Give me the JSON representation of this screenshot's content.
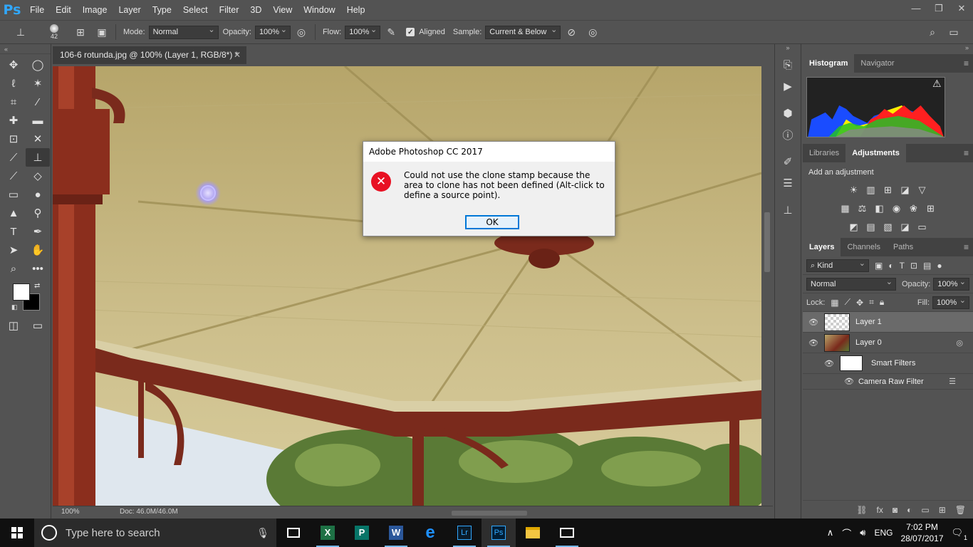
{
  "app": {
    "logo": "Ps"
  },
  "menu": [
    "File",
    "Edit",
    "Image",
    "Layer",
    "Type",
    "Select",
    "Filter",
    "3D",
    "View",
    "Window",
    "Help"
  ],
  "window_controls": {
    "minimize": "—",
    "restore": "❐",
    "close": "✕"
  },
  "options": {
    "brush_size": "42",
    "mode_label": "Mode:",
    "mode_value": "Normal",
    "opacity_label": "Opacity:",
    "opacity_value": "100%",
    "flow_label": "Flow:",
    "flow_value": "100%",
    "aligned_label": "Aligned",
    "sample_label": "Sample:",
    "sample_value": "Current & Below"
  },
  "document": {
    "tab_title": "106-6 rotunda.jpg @ 100% (Layer 1, RGB/8*) *",
    "zoom": "100%",
    "doc_info": "Doc: 46.0M/46.0M"
  },
  "dialog": {
    "title": "Adobe Photoshop CC 2017",
    "message": "Could not use the clone stamp because the area to clone has not been defined (Alt-click to define a source point).",
    "ok_label": "OK"
  },
  "panels": {
    "top_tabs": [
      "Histogram",
      "Navigator"
    ],
    "mid_tabs": [
      "Libraries",
      "Adjustments"
    ],
    "adjustments_title": "Add an adjustment",
    "layer_tabs": [
      "Layers",
      "Channels",
      "Paths"
    ],
    "filter_kind": "Kind",
    "blend_mode": "Normal",
    "opacity_label": "Opacity:",
    "opacity_value": "100%",
    "lock_label": "Lock:",
    "fill_label": "Fill:",
    "fill_value": "100%",
    "layers": [
      {
        "name": "Layer 1",
        "selected": true
      },
      {
        "name": "Layer 0",
        "selected": false
      },
      {
        "name": "Smart Filters"
      },
      {
        "name": "Camera Raw Filter"
      }
    ]
  },
  "taskbar": {
    "search_placeholder": "Type here to search",
    "language": "ENG",
    "time": "7:02 PM",
    "date": "28/07/2017",
    "notification_count": "1"
  },
  "colors": {
    "accent": "#31a8ff",
    "error": "#e81123",
    "panel_bg": "#535353"
  }
}
